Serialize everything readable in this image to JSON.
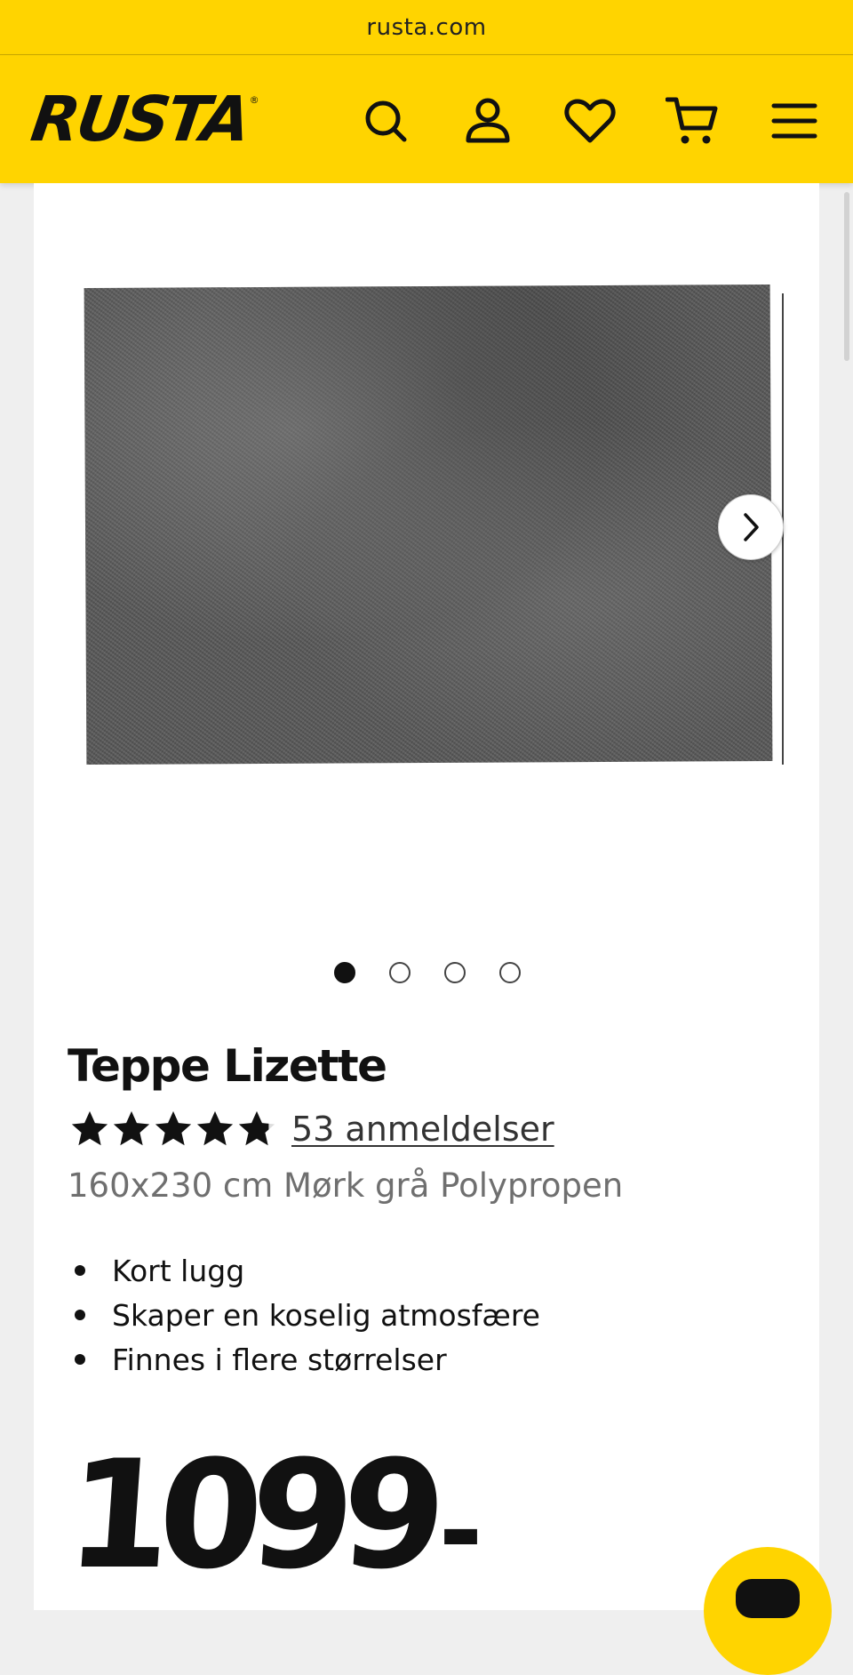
{
  "browser": {
    "url": "rusta.com"
  },
  "header": {
    "logo_text": "RUSTA",
    "logo_reg": "®",
    "icons": [
      "search-icon",
      "account-icon",
      "heart-icon",
      "cart-icon",
      "menu-icon"
    ],
    "brand_color": "#ffd400"
  },
  "gallery": {
    "slide_count": 4,
    "active_slide": 1
  },
  "product": {
    "title": "Teppe Lizette",
    "rating": 4.8,
    "rating_max": 5,
    "reviews_label": "53 anmeldelser",
    "subtitle": "160x230 cm Mørk grå Polypropen",
    "bullets": [
      "Kort lugg",
      "Skaper en koselig atmosfære",
      "Finnes i flere størrelser"
    ],
    "price": "1099",
    "price_suffix": "-"
  }
}
